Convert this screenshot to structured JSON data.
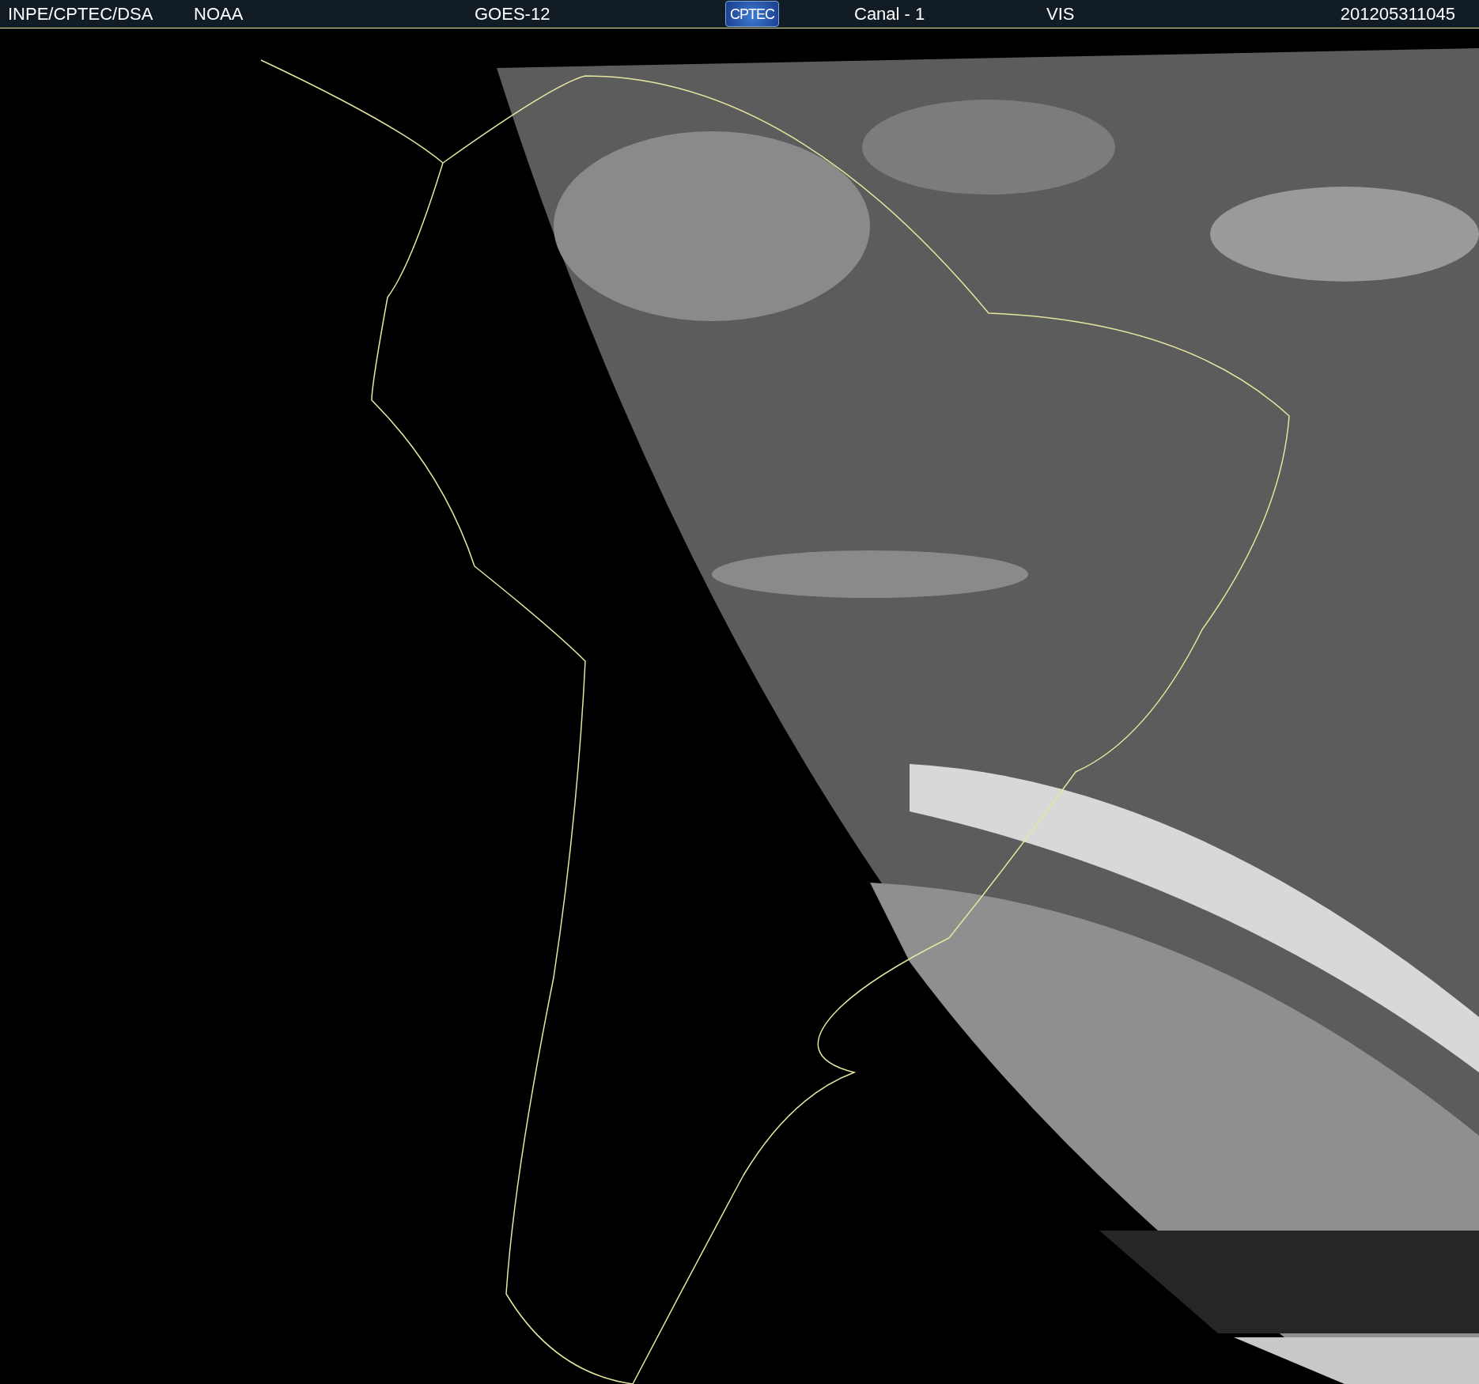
{
  "header": {
    "items": [
      {
        "kind": "text",
        "text": "INPE/CPTEC/DSA"
      },
      {
        "kind": "text",
        "text": "NOAA"
      },
      {
        "kind": "text",
        "text": "GOES-12"
      },
      {
        "kind": "logo",
        "text": "CPTEC"
      },
      {
        "kind": "text",
        "text": "Canal - 1"
      },
      {
        "kind": "text",
        "text": "VIS"
      },
      {
        "kind": "text",
        "text": "201205311045"
      }
    ]
  }
}
